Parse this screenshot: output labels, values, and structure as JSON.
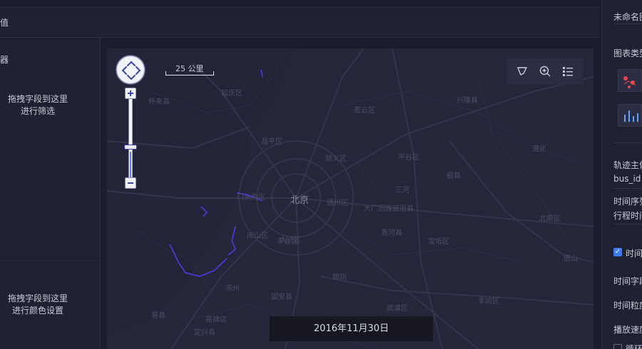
{
  "header": {
    "title_fragment": "值"
  },
  "left_panel": {
    "section_title": "器",
    "filter_drop_hint": [
      "拖拽字段到这里",
      "进行筛选"
    ],
    "color_drop_hint": [
      "拖拽字段到这里",
      "进行颜色设置"
    ]
  },
  "map": {
    "scale_label": "25 公里",
    "timeline_date": "2016年11月30日",
    "city_center": "北京",
    "places": [
      "延庆区",
      "怀来县",
      "昌平区",
      "顺义区",
      "平谷区",
      "密云区",
      "兴隆县",
      "遵化",
      "门头沟区",
      "通州区",
      "大厂回族自治县",
      "三河",
      "蓟县",
      "房山区",
      "丰台区",
      "大兴区",
      "香河县",
      "宝坻区",
      "廊坊",
      "涿州",
      "固安县",
      "武清区",
      "易县",
      "定兴县",
      "高碑店",
      "永清县",
      "北辰区",
      "丰润区",
      "唐山",
      "丰南区",
      "涞水县",
      "宣化区",
      "迁安"
    ],
    "tools": [
      "lasso-select-icon",
      "zoom-in-icon",
      "legend-list-icon"
    ]
  },
  "right_panel": {
    "name_input_value": "未命名图",
    "chart_type_label": "图表类型",
    "track_subject_label": "轨迹主体",
    "track_subject_value": "bus_id",
    "time_sequence_label": "时间序列",
    "time_sequence_value": "行程时间",
    "time_checkbox_label": "时间",
    "time_field_label": "时间字段",
    "time_granularity_label": "时间粒度",
    "play_speed_label": "播放速度",
    "loop_label": "循环"
  },
  "colors": {
    "background": "#1c1d2e",
    "panel": "#1f2032",
    "map_bg": "#25263a",
    "track": "#4b3df0",
    "accent": "#3d7bf2"
  }
}
